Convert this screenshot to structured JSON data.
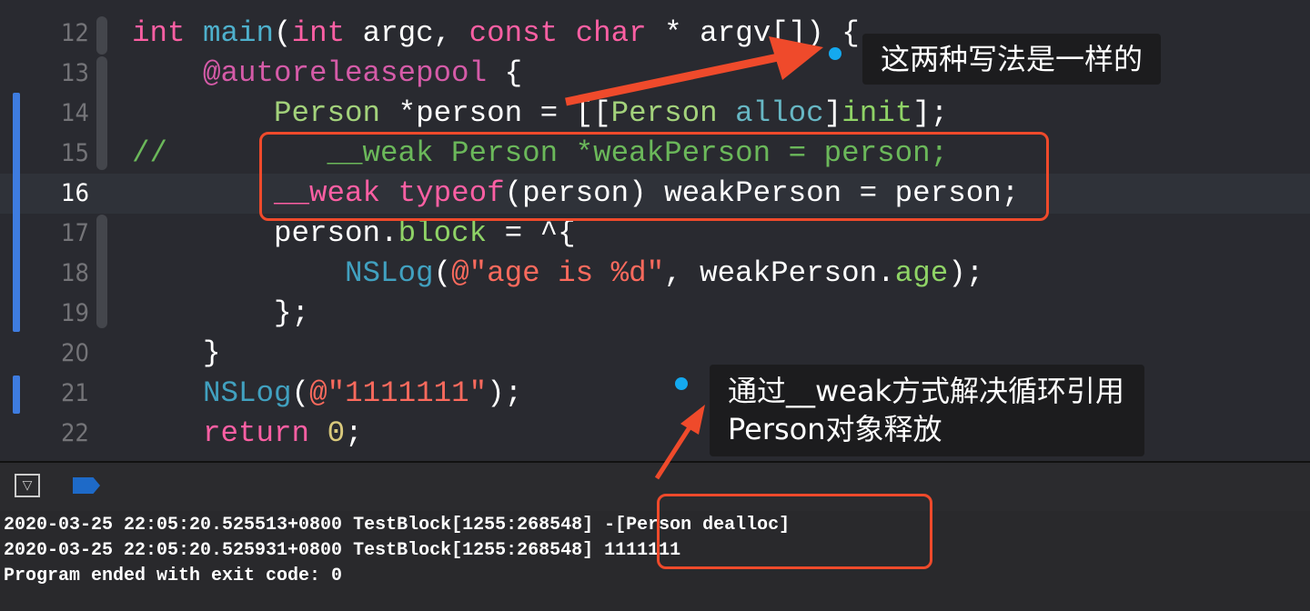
{
  "editor": {
    "current_line": "16",
    "lines": [
      {
        "num": "12",
        "segs": [
          [
            "int",
            "kw"
          ],
          " ",
          [
            "main",
            "fn"
          ],
          "(",
          [
            "int",
            "kw"
          ],
          " argc, ",
          [
            "const",
            "kw"
          ],
          " ",
          [
            "char",
            "kw"
          ],
          " * argv[]) {"
        ]
      },
      {
        "num": "13",
        "segs": [
          "    ",
          [
            "@autoreleasepool",
            "pk"
          ],
          " {"
        ]
      },
      {
        "num": "14",
        "segs": [
          "        ",
          [
            "Person",
            "ty"
          ],
          " *person = [[",
          [
            "Person",
            "ty"
          ],
          " ",
          [
            "alloc",
            "cl"
          ],
          "]",
          [
            "init",
            "pr"
          ],
          "];"
        ]
      },
      {
        "num": "15",
        "segs": [
          [
            "//         __weak Person *weakPerson = person;",
            "cm"
          ]
        ]
      },
      {
        "num": "16",
        "segs": [
          "        ",
          [
            "__weak",
            "kw"
          ],
          " ",
          [
            "typeof",
            "kw"
          ],
          "(person) weakPerson = person;"
        ]
      },
      {
        "num": "17",
        "segs": [
          "        person.",
          [
            "block",
            "pr"
          ],
          " = ^{"
        ]
      },
      {
        "num": "18",
        "segs": [
          "            ",
          [
            "NSLog",
            "ns"
          ],
          "(",
          [
            "@\"age is %d\"",
            "st"
          ],
          ", weakPerson.",
          [
            "age",
            "pr"
          ],
          ");"
        ]
      },
      {
        "num": "19",
        "segs": [
          "        };"
        ]
      },
      {
        "num": "20",
        "segs": [
          "    }"
        ]
      },
      {
        "num": "21",
        "segs": [
          "    ",
          [
            "NSLog",
            "ns"
          ],
          "(",
          [
            "@\"1111111\"",
            "st"
          ],
          ");"
        ]
      },
      {
        "num": "22",
        "segs": [
          "    ",
          [
            "return",
            "kw"
          ],
          " ",
          [
            "0",
            "nu"
          ],
          ";"
        ]
      }
    ]
  },
  "annotations": {
    "top": "这两种写法是一样的",
    "bottom_line1": "通过__weak方式解决循环引用",
    "bottom_line2": "Person对象释放"
  },
  "console": {
    "lines": [
      "2020-03-25 22:05:20.525513+0800 TestBlock[1255:268548] -[Person dealloc]",
      "2020-03-25 22:05:20.525931+0800 TestBlock[1255:268548] 1111111",
      "Program ended with exit code: 0"
    ]
  },
  "colors": {
    "annotation_red": "#ef4a2b",
    "dot_blue": "#14a9ef",
    "gutter_blue": "#3e7ce0"
  }
}
